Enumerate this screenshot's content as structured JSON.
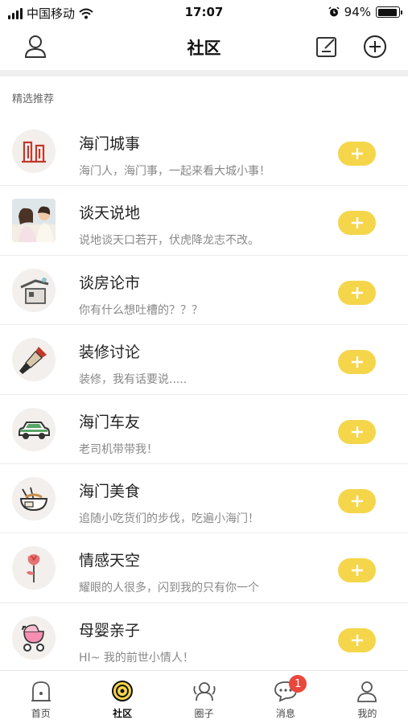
{
  "status_bar": {
    "carrier": "中国移动",
    "time": "17:07",
    "battery_text": "94%",
    "battery_level": 0.94
  },
  "nav": {
    "title": "社区",
    "icons": [
      "user-icon",
      "edit-icon",
      "add-circle-icon"
    ]
  },
  "section": {
    "title": "精选推荐"
  },
  "communities": [
    {
      "title": "海门城事",
      "desc": "海门人，海门事，一起来看大城小事！",
      "icon": "city-buildings-icon"
    },
    {
      "title": "谈天说地",
      "desc": "说地谈天口若开，伏虎降龙志不改。",
      "icon": "chatting-friends-photo"
    },
    {
      "title": "谈房论市",
      "desc": "你有什么想吐槽的？？？",
      "icon": "house-icon"
    },
    {
      "title": "装修讨论",
      "desc": "装修，我有话要说.....",
      "icon": "paint-brush-icon"
    },
    {
      "title": "海门车友",
      "desc": "老司机带带我！",
      "icon": "car-icon"
    },
    {
      "title": "海门美食",
      "desc": "追随小吃货们的步伐，吃遍小海门！",
      "icon": "food-bowl-icon"
    },
    {
      "title": "情感天空",
      "desc": "耀眼的人很多，闪到我的只有你一个",
      "icon": "rose-icon"
    },
    {
      "title": "母婴亲子",
      "desc": "HI~ 我的前世小情人！",
      "icon": "baby-stroller-icon"
    }
  ],
  "tabs": [
    {
      "label": "首页",
      "icon": "home-icon",
      "active": false
    },
    {
      "label": "社区",
      "icon": "community-icon",
      "active": true
    },
    {
      "label": "圈子",
      "icon": "circle-icon",
      "active": false
    },
    {
      "label": "消息",
      "icon": "message-icon",
      "active": false,
      "badge": "1"
    },
    {
      "label": "我的",
      "icon": "profile-icon",
      "active": false
    }
  ],
  "colors": {
    "accent": "#f5d64a",
    "badge": "#e8473d",
    "divider": "#ececec"
  }
}
